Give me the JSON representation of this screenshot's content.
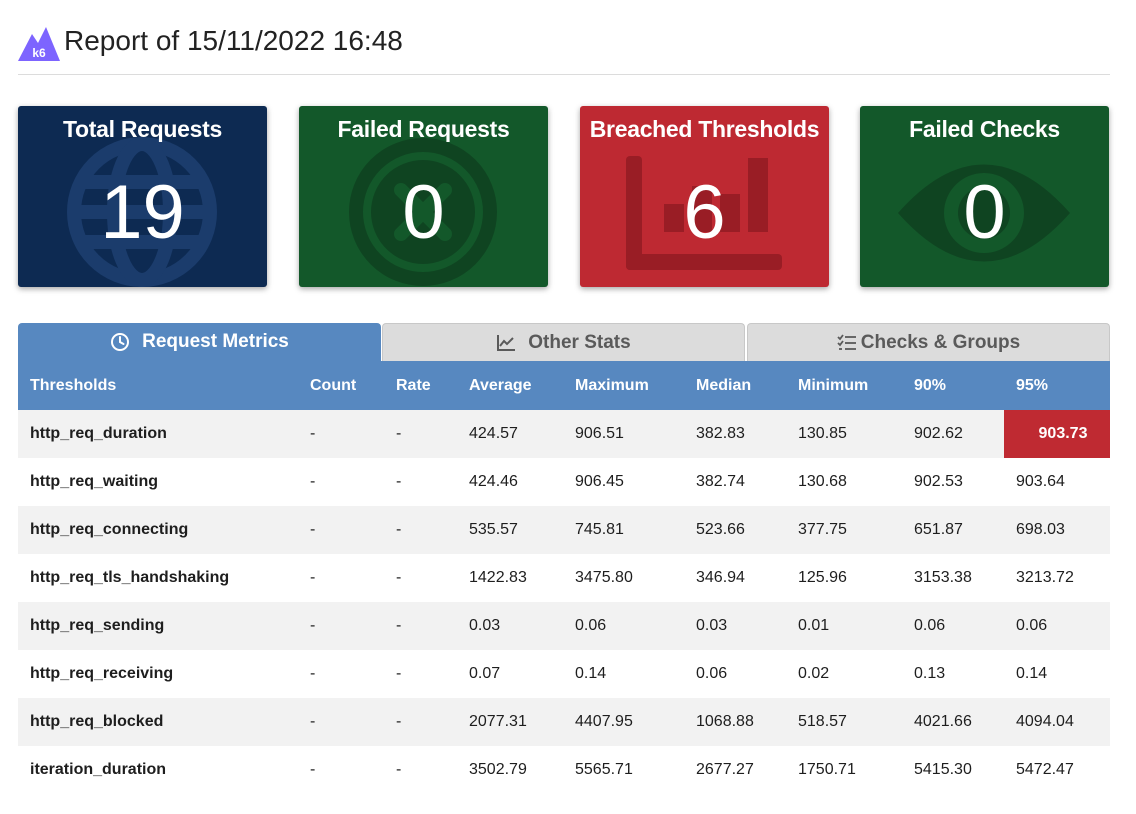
{
  "report": {
    "logo_text": "k6",
    "title": "Report of 15/11/2022 16:48"
  },
  "cards": [
    {
      "title": "Total Requests",
      "value": "19",
      "color": "#0d2a52",
      "icon": "globe-icon"
    },
    {
      "title": "Failed Requests",
      "value": "0",
      "color": "#13582a",
      "icon": "times-circle-icon"
    },
    {
      "title": "Breached Thresholds",
      "value": "6",
      "color": "#be2932",
      "icon": "chart-bar-icon"
    },
    {
      "title": "Failed Checks",
      "value": "0",
      "color": "#13582a",
      "icon": "eye-icon"
    }
  ],
  "tabs": [
    {
      "label": "Request Metrics",
      "icon": "clock-icon",
      "active": true
    },
    {
      "label": "Other Stats",
      "icon": "chart-line-icon",
      "active": false
    },
    {
      "label": "Checks & Groups",
      "icon": "tasks-icon",
      "active": false
    }
  ],
  "table": {
    "headers": [
      "Thresholds",
      "Count",
      "Rate",
      "Average",
      "Maximum",
      "Median",
      "Minimum",
      "90%",
      "95%"
    ],
    "rows": [
      {
        "name": "http_req_duration",
        "count": "-",
        "rate": "-",
        "avg": "424.57",
        "max": "906.51",
        "med": "382.83",
        "min": "130.85",
        "p90": "902.62",
        "p95": "903.73",
        "p95_breached": true
      },
      {
        "name": "http_req_waiting",
        "count": "-",
        "rate": "-",
        "avg": "424.46",
        "max": "906.45",
        "med": "382.74",
        "min": "130.68",
        "p90": "902.53",
        "p95": "903.64"
      },
      {
        "name": "http_req_connecting",
        "count": "-",
        "rate": "-",
        "avg": "535.57",
        "max": "745.81",
        "med": "523.66",
        "min": "377.75",
        "p90": "651.87",
        "p95": "698.03"
      },
      {
        "name": "http_req_tls_handshaking",
        "count": "-",
        "rate": "-",
        "avg": "1422.83",
        "max": "3475.80",
        "med": "346.94",
        "min": "125.96",
        "p90": "3153.38",
        "p95": "3213.72"
      },
      {
        "name": "http_req_sending",
        "count": "-",
        "rate": "-",
        "avg": "0.03",
        "max": "0.06",
        "med": "0.03",
        "min": "0.01",
        "p90": "0.06",
        "p95": "0.06"
      },
      {
        "name": "http_req_receiving",
        "count": "-",
        "rate": "-",
        "avg": "0.07",
        "max": "0.14",
        "med": "0.06",
        "min": "0.02",
        "p90": "0.13",
        "p95": "0.14"
      },
      {
        "name": "http_req_blocked",
        "count": "-",
        "rate": "-",
        "avg": "2077.31",
        "max": "4407.95",
        "med": "1068.88",
        "min": "518.57",
        "p90": "4021.66",
        "p95": "4094.04"
      },
      {
        "name": "iteration_duration",
        "count": "-",
        "rate": "-",
        "avg": "3502.79",
        "max": "5565.71",
        "med": "2677.27",
        "min": "1750.71",
        "p90": "5415.30",
        "p95": "5472.47"
      }
    ]
  }
}
